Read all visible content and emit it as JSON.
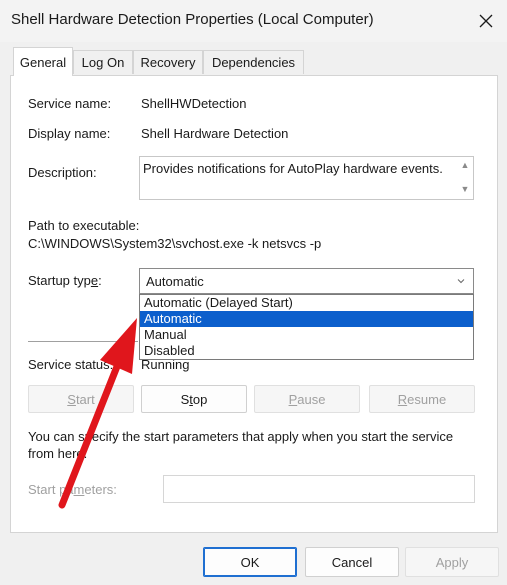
{
  "window": {
    "title": "Shell Hardware Detection Properties (Local Computer)"
  },
  "tabs": [
    {
      "label": "General",
      "active": true
    },
    {
      "label": "Log On",
      "active": false
    },
    {
      "label": "Recovery",
      "active": false
    },
    {
      "label": "Dependencies",
      "active": false
    }
  ],
  "general": {
    "service_name_label": "Service name:",
    "service_name_value": "ShellHWDetection",
    "display_name_label": "Display name:",
    "display_name_value": "Shell Hardware Detection",
    "description_label": "Description:",
    "description_value": "Provides notifications for AutoPlay hardware events.",
    "path_label": "Path to executable:",
    "path_value": "C:\\WINDOWS\\System32\\svchost.exe -k netsvcs -p",
    "startup_type_label_pre": "Startup typ",
    "startup_type_label_key": "e",
    "startup_type_label_post": ":",
    "startup_type_value": "Automatic",
    "startup_options": [
      {
        "label": "Automatic (Delayed Start)",
        "selected": false
      },
      {
        "label": "Automatic",
        "selected": true
      },
      {
        "label": "Manual",
        "selected": false
      },
      {
        "label": "Disabled",
        "selected": false
      }
    ],
    "service_status_label": "Service status:",
    "service_status_value": "Running",
    "buttons": {
      "start": {
        "key": "S",
        "rest": "tart"
      },
      "stop": {
        "pre": "S",
        "key": "t",
        "rest": "op"
      },
      "pause": {
        "key": "P",
        "rest": "ause"
      },
      "resume": {
        "key": "R",
        "rest": "esume"
      }
    },
    "start_params_info": "You can specify the start parameters that apply when you start the service from here.",
    "start_params_label_pre": "Start pa",
    "start_params_label_key": "m",
    "start_params_label_post": "eters:",
    "start_params_value": ""
  },
  "footer": {
    "ok_label": "OK",
    "cancel_label": "Cancel",
    "apply_label": "Apply"
  },
  "colors": {
    "selection": "#0c5fcc",
    "annotation_arrow": "#e0161c"
  }
}
